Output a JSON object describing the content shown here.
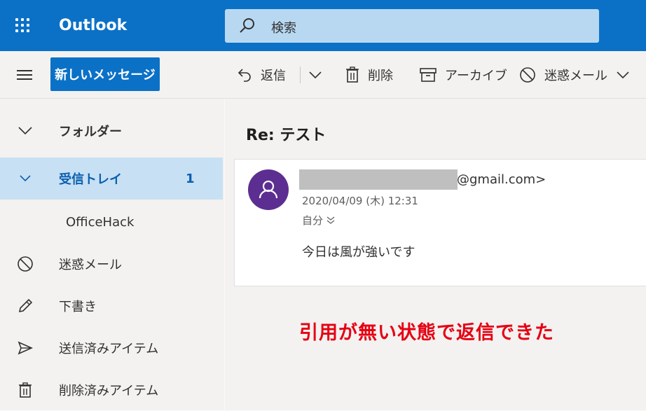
{
  "app": {
    "name": "Outlook"
  },
  "search": {
    "placeholder": "検索"
  },
  "toolbar": {
    "new_message": "新しいメッセージ",
    "reply": "返信",
    "delete": "削除",
    "archive": "アーカイブ",
    "junk": "迷惑メール"
  },
  "nav": {
    "folders": "フォルダー",
    "inbox": "受信トレイ",
    "inbox_count": "1",
    "officehack": "OfficeHack",
    "junk": "迷惑メール",
    "drafts": "下書き",
    "sent": "送信済みアイテム",
    "deleted": "削除済みアイテム"
  },
  "message": {
    "subject": "Re: テスト",
    "sender_email": "@gmail.com>",
    "date": "2020/04/09 (木) 12:31",
    "to": "自分",
    "body": "今日は風が強いです"
  },
  "annotation": "引用が無い状態で返信できた",
  "colors": {
    "brand": "#0b71c7",
    "selected": "#c7e0f4",
    "avatar": "#5c2e91",
    "annotation": "#e60012"
  }
}
